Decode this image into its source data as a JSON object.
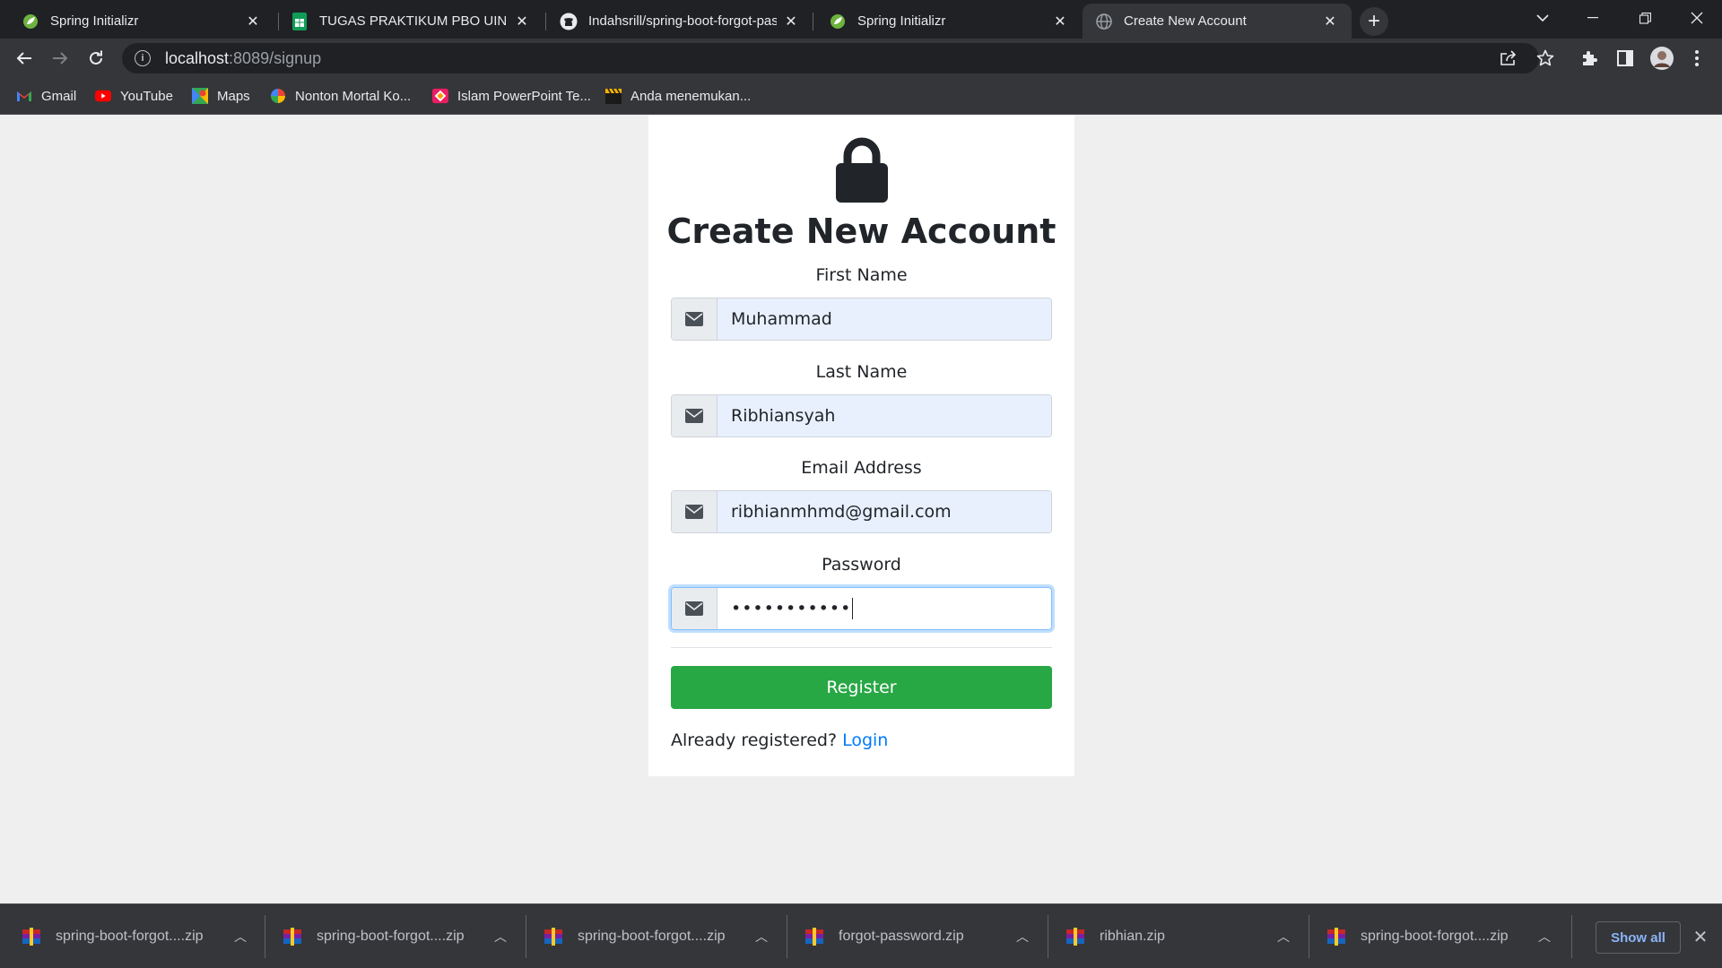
{
  "browser": {
    "tabs": [
      {
        "title": "Spring Initializr",
        "icon": "spring-icon",
        "active": false
      },
      {
        "title": "TUGAS PRAKTIKUM PBO UIN SGD",
        "icon": "sheets-icon",
        "active": false
      },
      {
        "title": "Indahsrill/spring-boot-forgot-pass",
        "icon": "github-icon",
        "active": false
      },
      {
        "title": "Spring Initializr",
        "icon": "spring-icon",
        "active": false
      },
      {
        "title": "Create New Account",
        "icon": "globe-icon",
        "active": true
      }
    ],
    "address": {
      "host": "localhost",
      "path": ":8089/signup"
    },
    "bookmarks": [
      {
        "label": "Gmail",
        "icon": "gmail-icon"
      },
      {
        "label": "YouTube",
        "icon": "youtube-icon"
      },
      {
        "label": "Maps",
        "icon": "maps-icon"
      },
      {
        "label": "Nonton Mortal Ko...",
        "icon": "pinwheel-icon"
      },
      {
        "label": "Islam PowerPoint Te...",
        "icon": "slides-icon"
      },
      {
        "label": "Anda menemukan...",
        "icon": "clapper-icon"
      }
    ]
  },
  "page": {
    "title": "Create New Account",
    "fields": {
      "first_name": {
        "label": "First Name",
        "value": "Muhammad"
      },
      "last_name": {
        "label": "Last Name",
        "value": "Ribhiansyah"
      },
      "email": {
        "label": "Email Address",
        "value": "ribhianmhmd@gmail.com"
      },
      "password": {
        "label": "Password",
        "value": "•••••••••••"
      }
    },
    "register_label": "Register",
    "already_text": "Already registered?",
    "login_label": "Login"
  },
  "downloads": {
    "items": [
      "spring-boot-forgot....zip",
      "spring-boot-forgot....zip",
      "spring-boot-forgot....zip",
      "forgot-password.zip",
      "ribhian.zip",
      "spring-boot-forgot....zip"
    ],
    "show_all_label": "Show all"
  },
  "colors": {
    "register_button": "#28a745",
    "link": "#007bff",
    "autofill_background": "#e8f0fe",
    "page_background": "#efefef"
  }
}
